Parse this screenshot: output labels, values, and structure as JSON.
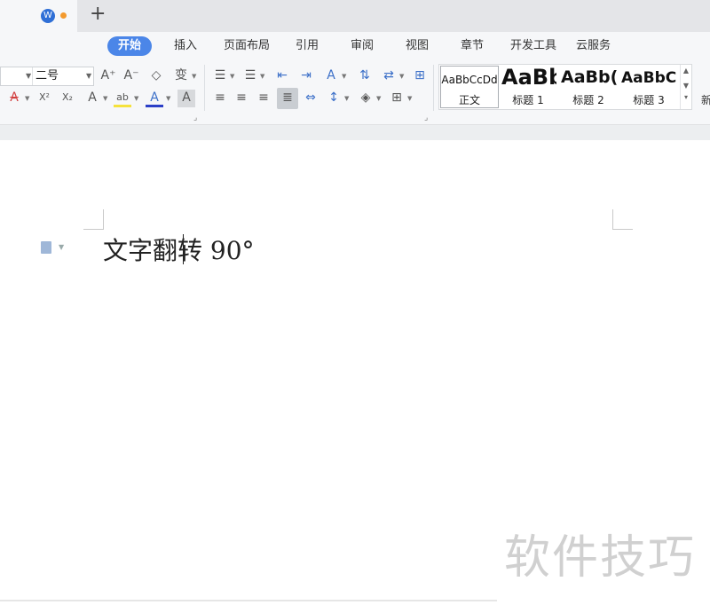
{
  "tabs": {
    "plus": "+",
    "doc_icon_glyph": "W"
  },
  "menu": [
    "开始",
    "插入",
    "页面布局",
    "引用",
    "审阅",
    "视图",
    "章节",
    "开发工具",
    "云服务"
  ],
  "ribbon": {
    "font_size_value": "二号",
    "styles": [
      {
        "preview": "AaBbCcDd",
        "name": "正文"
      },
      {
        "preview": "AaBb",
        "name": "标题 1"
      },
      {
        "preview": "AaBb(",
        "name": "标题 2"
      },
      {
        "preview": "AaBbC",
        "name": "标题 3"
      }
    ],
    "new_label": "新",
    "buttons": {
      "grow_font": "A⁺",
      "shrink_font": "A⁻",
      "clear_format": "◇",
      "pinyin": "变",
      "strike": "A",
      "superscript": "X²",
      "subscript": "X₂",
      "outline_font": "A",
      "highlight": "ab",
      "font_color": "A",
      "char_shade": "A"
    }
  },
  "document": {
    "text": "文字翻转 90°"
  },
  "watermark": "软件技巧",
  "colors": {
    "accent": "#4b86e8",
    "tab_dot": "#f39a2e"
  }
}
